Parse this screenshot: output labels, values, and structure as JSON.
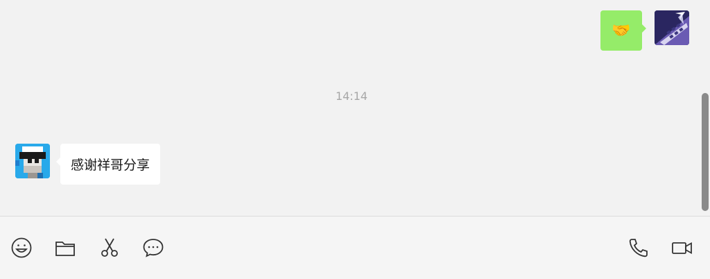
{
  "messages": {
    "sent": {
      "content": "🤝",
      "bubble_color": "#95ec69"
    },
    "timestamp": "14:14",
    "received": {
      "content": "感谢祥哥分享"
    }
  },
  "toolbar": {
    "icons": [
      "emoji-icon",
      "folder-icon",
      "scissors-icon",
      "chat-bubble-icon",
      "phone-icon",
      "video-call-icon"
    ]
  }
}
